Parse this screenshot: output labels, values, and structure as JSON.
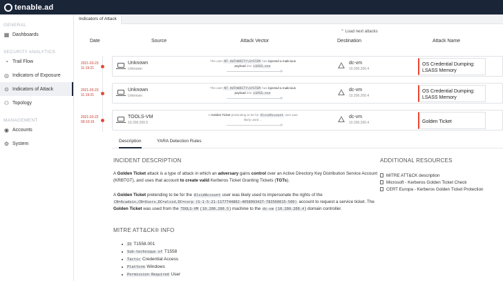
{
  "brand": {
    "name": "tenable.ad"
  },
  "sidebar": {
    "sections": [
      {
        "title": "GENERAL",
        "items": [
          {
            "label": "Dashboards",
            "icon": "dashboard-icon"
          }
        ]
      },
      {
        "title": "SECURITY ANALYTICS",
        "items": [
          {
            "label": "Trail Flow",
            "icon": "trail-flow-icon"
          },
          {
            "label": "Indicators of Exposure",
            "icon": "exposure-icon"
          },
          {
            "label": "Indicators of Attack",
            "icon": "attack-icon",
            "active": true
          },
          {
            "label": "Topology",
            "icon": "topology-icon"
          }
        ]
      },
      {
        "title": "MANAGEMENT",
        "items": [
          {
            "label": "Accounts",
            "icon": "accounts-icon"
          },
          {
            "label": "System",
            "icon": "gear-icon"
          }
        ]
      }
    ]
  },
  "main": {
    "tab": "Indicators of Attack",
    "columns": {
      "date": "Date",
      "source": "Source",
      "vector": "Attack Vector",
      "destination": "Destination",
      "attack": "Attack Name"
    },
    "load_more": "Load next attacks",
    "rows": [
      {
        "date": "2021-03-23",
        "time": "11:19:21",
        "source": "Unknown",
        "source_sub": "Unknown",
        "vec_pre": "The user",
        "vec_code1": "NT AUTHORITY\\SYSTEM",
        "vec_mid": "has",
        "vec_bold": "injected a malicious payload",
        "vec_into": "into",
        "vec_code2": "LSASS.exe",
        "dest": "dc-vm",
        "dest_sub": "10.200.200.4",
        "attack": "OS Credential Dumping: LSASS Memory"
      },
      {
        "date": "2021-03-23",
        "time": "11:19:21",
        "source": "Unknown",
        "source_sub": "Unknown",
        "vec_pre": "The user",
        "vec_code1": "NT AUTHORITY\\SYSTEM",
        "vec_mid": "has",
        "vec_bold": "injected a malicious payload",
        "vec_into": "into",
        "vec_code2": "LSASS.exe",
        "dest": "dc-vm",
        "dest_sub": "10.200.200.4",
        "attack": "OS Credential Dumping: LSASS Memory"
      },
      {
        "date": "2021-03-22",
        "time": "09:10:15",
        "source": "TOOLS-VM",
        "source_sub": "10.200.200.5",
        "vec_pre": "A",
        "vec_code1": "",
        "vec_mid": "",
        "vec_bold": "Golden Ticket",
        "vec_into": "pretending to be for",
        "vec_code2": "AlsidAccount",
        "vec_tail": "user was likely used ...",
        "dest": "dc-vm",
        "dest_sub": "10.200.200.4",
        "attack": "Golden Ticket"
      }
    ]
  },
  "detail": {
    "tabs": [
      "Description",
      "YARA Detection Rules"
    ],
    "incident_title": "INCIDENT DESCRIPTION",
    "p1": {
      "a": "A",
      "b1": "Golden Ticket",
      "c": "attack is a type of attack in which an",
      "b2": "adversary",
      "d": "gains",
      "b3": "control",
      "e": "over an Active Directory Key Distribution Service Account (KRBTGT), and uses that account",
      "b4": "to create valid",
      "f": "Kerberos Ticket Granting Tickets (",
      "b5": "TGTs",
      "g": ")."
    },
    "p2": {
      "a": "A",
      "b1": "Golden Ticket",
      "c": "pretending to be for the",
      "m1": "AlsidAccount",
      "d": "user was likely used to impersonate the rights of the",
      "m2": "CN=Acadein,CN=Users,DC=alsid,DC=corp (S-1-5-21-1177744802-4058093427-783560015-500)",
      "e": "account to request a service ticket. The",
      "b2": "Golden Ticket",
      "f": "was used from the",
      "m3": "TOOLS-VM",
      "m4": "10.200.200.5",
      "g": "machine to the",
      "m5": "dc-vm",
      "m6": "10.200.200.4",
      "h": "domain controller."
    },
    "mitre_title": "MITRE ATT&CK® INFO",
    "mitre": [
      {
        "key": "ID",
        "value": "T1558.001"
      },
      {
        "key": "Sub-technique of",
        "value": "T1558"
      },
      {
        "key": "Tactic",
        "value": "Credential Access"
      },
      {
        "key": "Platform",
        "value": "Windows"
      },
      {
        "key": "Permission Required",
        "value": "User"
      }
    ],
    "resources_title": "ADDITIONAL RESOURCES",
    "resources": [
      "MITRE ATT&CK description",
      "Microsoft - Kerberos Golden Ticket Check",
      "CERT Europa - Kerberos Golden Ticket Protection"
    ]
  }
}
